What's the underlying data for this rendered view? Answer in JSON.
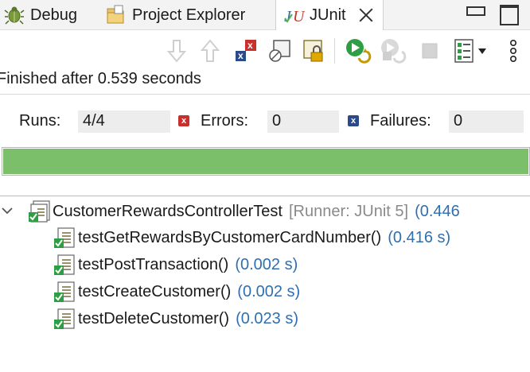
{
  "tabs": [
    {
      "label": "Debug",
      "icon": "bug-icon",
      "active": false
    },
    {
      "label": "Project Explorer",
      "icon": "folder-icon",
      "active": false
    },
    {
      "label": "JUnit",
      "icon": "junit-icon",
      "active": true
    }
  ],
  "toolbar": {
    "items": [
      "next-failure-icon",
      "previous-failure-icon",
      "show-failures-only-icon",
      "show-skipped-tests-icon",
      "scroll-lock-icon",
      "rerun-test-icon",
      "rerun-failed-first-icon",
      "stop-icon",
      "test-run-history-icon",
      "view-menu-icon"
    ]
  },
  "status": {
    "text": "Finished after 0.539 seconds"
  },
  "counters": {
    "runs_label": "Runs:",
    "runs_value": "4/4",
    "errors_label": "Errors:",
    "errors_value": "0",
    "failures_label": "Failures:",
    "failures_value": "0"
  },
  "progress": {
    "fraction": 1.0,
    "color": "#7bbf6a"
  },
  "tree": {
    "root": {
      "name": "CustomerRewardsControllerTest",
      "runner": "[Runner: JUnit 5]",
      "time": "(0.446"
    },
    "tests": [
      {
        "name": "testGetRewardsByCustomerCardNumber()",
        "time": "(0.416 s)"
      },
      {
        "name": "testPostTransaction()",
        "time": "(0.002 s)"
      },
      {
        "name": "testCreateCustomer()",
        "time": "(0.002 s)"
      },
      {
        "name": "testDeleteCustomer()",
        "time": "(0.023 s)"
      }
    ]
  }
}
